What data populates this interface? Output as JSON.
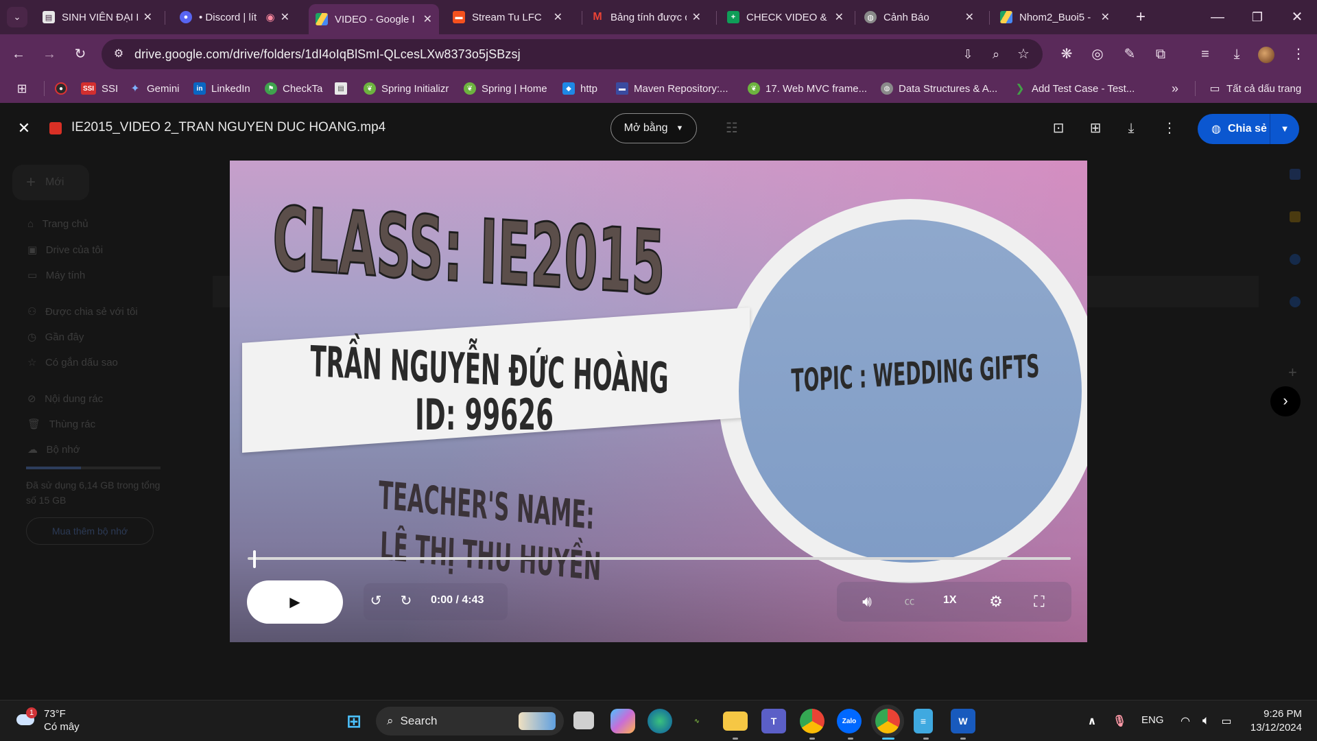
{
  "browser": {
    "tabs": [
      {
        "title": "SINH VIÊN ĐẠI H",
        "active": false
      },
      {
        "title": "• Discord | lít",
        "active": false
      },
      {
        "title": "VIDEO - Google I",
        "active": true
      },
      {
        "title": "Stream Tu LFC",
        "active": false
      },
      {
        "title": "Bảng tính được c",
        "active": false
      },
      {
        "title": "CHECK VIDEO &",
        "active": false
      },
      {
        "title": "Cảnh Báo",
        "active": false
      },
      {
        "title": "Nhom2_Buoi5 -",
        "active": false
      }
    ],
    "url": "drive.google.com/drive/folders/1dI4oIqBlSmI-QLcesLXw8373o5jSBzsj",
    "bookmarks": [
      "SSI",
      "Gemini",
      "LinkedIn",
      "CheckTa",
      "Spring Initializr",
      "Spring | Home",
      "http",
      "Maven Repository:...",
      "17. Web MVC frame...",
      "Data Structures & A...",
      "Add Test Case - Test..."
    ],
    "all_bookmarks": "Tất cả dấu trang"
  },
  "drive_bg": {
    "new_button": "Mới",
    "nav": [
      "Trang chủ",
      "Drive của tôi",
      "Máy tính",
      "Được chia sẻ với tôi",
      "Gần đây",
      "Có gắn dấu sao",
      "Nội dung rác",
      "Thùng rác",
      "Bộ nhớ"
    ],
    "storage_text": "Đã sử dụng 6,14 GB trong tổng số 15 GB",
    "buy_storage": "Mua thêm bộ nhớ"
  },
  "viewer": {
    "filename": "IE2015_VIDEO 2_TRAN NGUYEN DUC HOANG.mp4",
    "open_with": "Mở bằng",
    "share": "Chia sẻ"
  },
  "video": {
    "class_text": "CLASS: IE2015",
    "student_name": "TRẦN NGUYỄN ĐỨC HOÀNG",
    "student_id": "ID: 99626",
    "teacher_label": "TEACHER'S NAME:",
    "teacher_name": "LÊ THỊ THU HUYỀN",
    "topic": "TOPIC : WEDDING GIFTS",
    "time": "0:00 / 4:43",
    "speed": "1X",
    "progress": 0.0
  },
  "taskbar": {
    "weather_temp": "73°F",
    "weather_desc": "Có mây",
    "search": "Search",
    "lang": "ENG",
    "time": "9:26 PM",
    "date": "13/12/2024",
    "weather_badge": "1"
  }
}
